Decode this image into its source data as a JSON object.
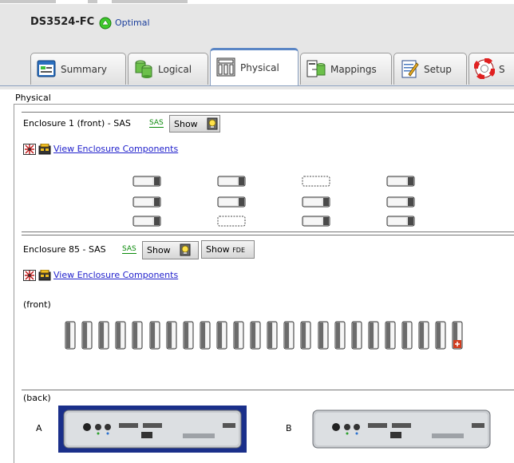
{
  "header": {
    "system_name": "DS3524-FC",
    "status": "Optimal"
  },
  "tabs": [
    {
      "label": "Summary",
      "icon": "summary-icon",
      "active": false
    },
    {
      "label": "Logical",
      "icon": "logical-icon",
      "active": false
    },
    {
      "label": "Physical",
      "icon": "physical-icon",
      "active": true
    },
    {
      "label": "Mappings",
      "icon": "mappings-icon",
      "active": false
    },
    {
      "label": "Setup",
      "icon": "setup-icon",
      "active": false
    },
    {
      "label": "S",
      "icon": "support-icon",
      "active": false
    }
  ],
  "content": {
    "title": "Physical",
    "enclosure1": {
      "label": "Enclosure 1 (front) - SAS",
      "badge": "SAS",
      "show_label": "Show",
      "link": "View Enclosure Components",
      "drive_rows": [
        [
          "present",
          "present",
          "empty",
          "present"
        ],
        [
          "present",
          "present",
          "present",
          "present"
        ],
        [
          "present",
          "empty",
          "present",
          "present"
        ]
      ]
    },
    "enclosure85": {
      "label": "Enclosure 85 - SAS",
      "badge": "SAS",
      "show_label": "Show",
      "show_fde_label": "Show",
      "show_fde_suffix": "FDE",
      "link": "View Enclosure Components",
      "front_label": "(front)",
      "back_label": "(back)",
      "drive_count": 24,
      "controllers": [
        {
          "label": "A",
          "selected": true
        },
        {
          "label": "B",
          "selected": false
        }
      ]
    }
  },
  "colors": {
    "link": "#2222cc",
    "status_ok": "#33cc33",
    "tab_active_accent": "#5b86c5",
    "selected_controller": "#1a2f8a",
    "drive_fault": "#d23b1e"
  }
}
